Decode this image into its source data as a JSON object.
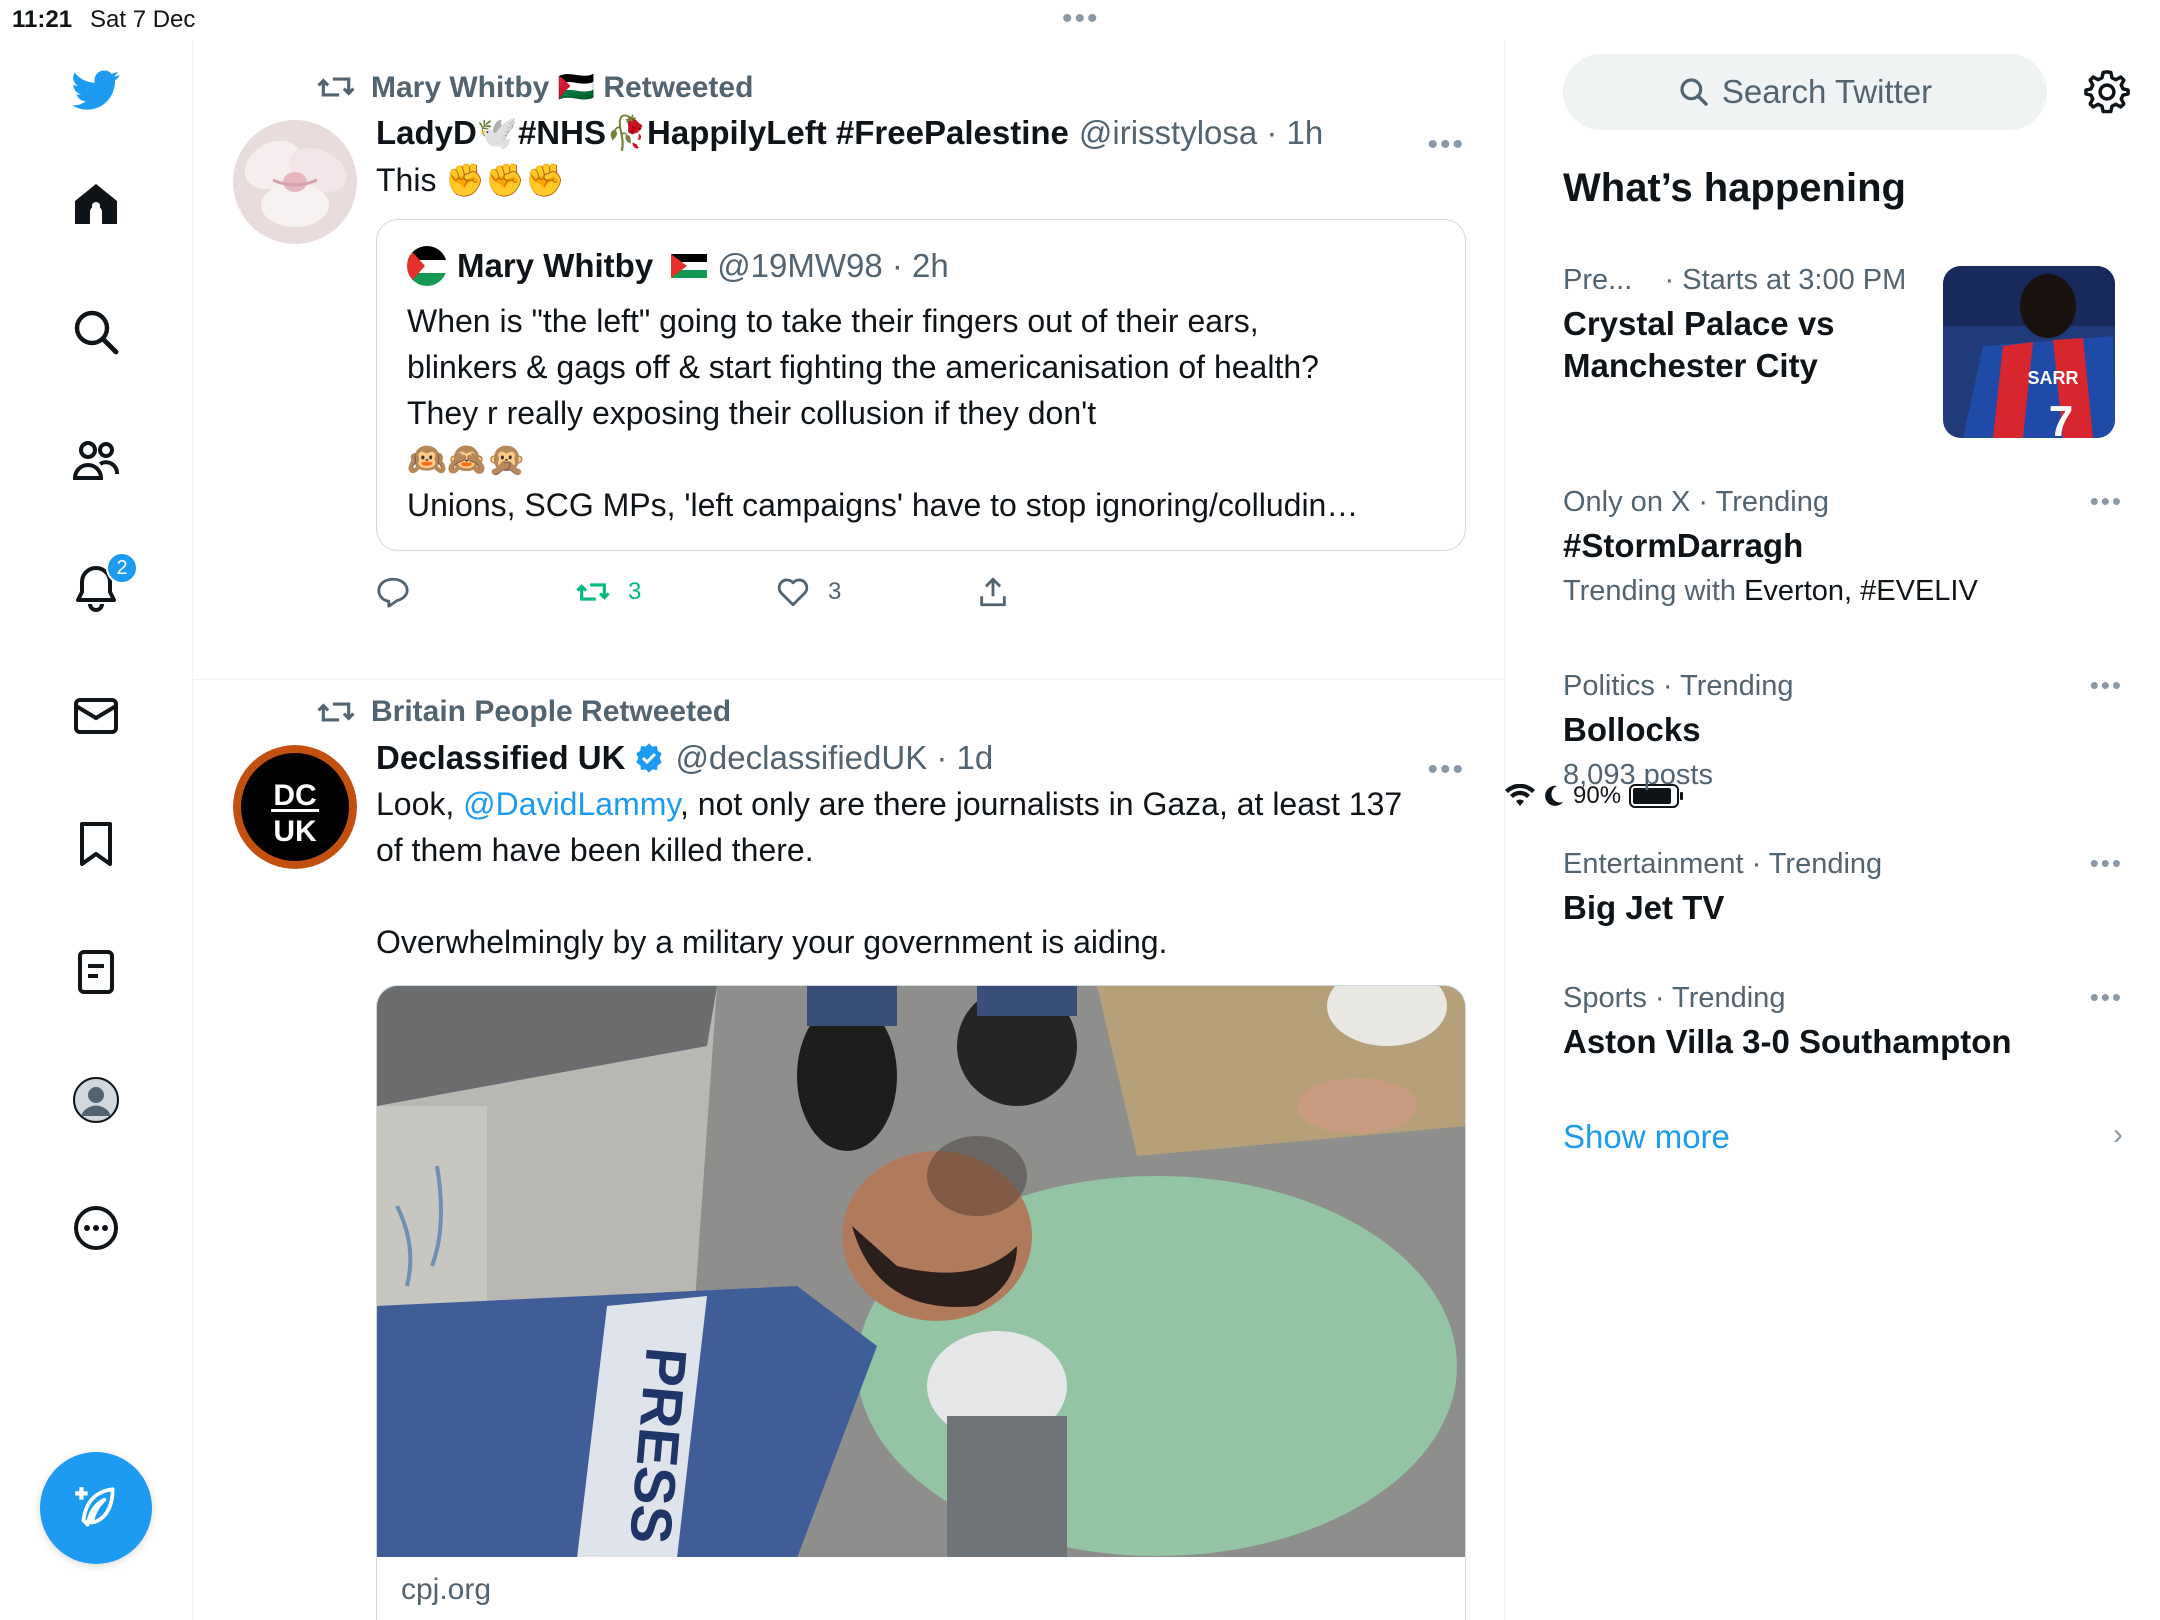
{
  "status_bar": {
    "time": "11:21",
    "date": "Sat 7 Dec",
    "battery": "90%",
    "battery_level": 0.9
  },
  "nav": {
    "notifications_badge": "2"
  },
  "tweets": [
    {
      "retweeted_by": "Mary Whitby 🇵🇸 Retweeted",
      "name": "LadyD🕊️#NHS🥀HappilyLeft #FreePalestine",
      "handle": "@irisstylosa · 1h",
      "text": "This ✊✊✊",
      "quote": {
        "name": "Mary Whitby",
        "handle": "@19MW98 · 2h",
        "text": "When is \"the left\" going to take their fingers out of their ears,\nblinkers & gags off & start fighting the americanisation of health?\nThey r really exposing their collusion if they don't\n🙉🙈🙊\nUnions, SCG MPs, 'left campaigns' have to stop ignoring/colludin…"
      },
      "actions": {
        "replies": "",
        "retweets": "3",
        "likes": "3"
      }
    },
    {
      "retweeted_by": "Britain People Retweeted",
      "name": "Declassified UK",
      "handle": "@declassifiedUK · 1d",
      "text_before": "Look, ",
      "mention": "@DavidLammy",
      "text_after": ", not only are there journalists in Gaza, at least 137\nof them have been killed there.\n\nOverwhelmingly by a military your government is aiding.",
      "media_caption": "cpj.org"
    }
  ],
  "sidebar": {
    "search_placeholder": "Search Twitter",
    "heading": "What’s happening",
    "event": {
      "meta_a": "Pre...",
      "meta_b": "· Starts at 3:00 PM",
      "topic": "Crystal Palace vs\nManchester City"
    },
    "trends": [
      {
        "meta": "Only on X · Trending",
        "topic": "#StormDarragh",
        "sub_label": "Trending with ",
        "sub_value": "Everton, #EVELIV"
      },
      {
        "meta": "Politics · Trending",
        "topic": "Bollocks",
        "sub_label": "8,093 posts",
        "sub_value": ""
      },
      {
        "meta": "Entertainment · Trending",
        "topic": "Big Jet TV",
        "sub_label": "",
        "sub_value": ""
      },
      {
        "meta": "Sports · Trending",
        "topic": "Aston Villa 3-0 Southampton",
        "sub_label": "",
        "sub_value": ""
      }
    ],
    "show_more": "Show more"
  },
  "colors": {
    "accent": "#1d9bf0",
    "retweet": "#00ba7c",
    "muted": "#536471"
  }
}
